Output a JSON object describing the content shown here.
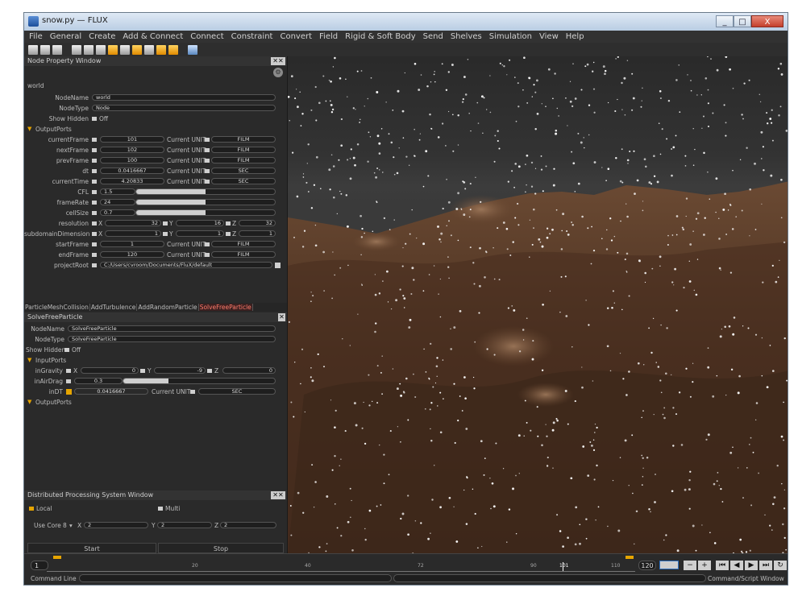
{
  "window": {
    "title": "snow.py — FLUX",
    "min": "_",
    "max": "□",
    "close": "X"
  },
  "menu": [
    "File",
    "General",
    "Create",
    "Add & Connect",
    "Connect",
    "Constraint",
    "Convert",
    "Field",
    "Rigid & Soft Body",
    "Send",
    "Shelves",
    "Simulation",
    "View",
    "Help"
  ],
  "node_property": {
    "title": "Node Property Window",
    "node": "world",
    "node_name_label": "NodeName",
    "node_name": "world",
    "node_type_label": "NodeType",
    "node_type": "Node",
    "show_hidden_label": "Show Hidden",
    "show_hidden": "Off",
    "output_ports": "OutputPorts",
    "unit_label": "Current UNIT",
    "ports": {
      "currentFrame": {
        "label": "currentFrame",
        "value": "101",
        "unit": "FILM"
      },
      "nextFrame": {
        "label": "nextFrame",
        "value": "102",
        "unit": "FILM"
      },
      "prevFrame": {
        "label": "prevFrame",
        "value": "100",
        "unit": "FILM"
      },
      "dt": {
        "label": "dt",
        "value": "0.0416667",
        "unit": "SEC"
      },
      "currentTime": {
        "label": "currentTime",
        "value": "4.20833",
        "unit": "SEC"
      },
      "CFL": {
        "label": "CFL",
        "value": "1.5",
        "fill": 0.5
      },
      "frameRate": {
        "label": "frameRate",
        "value": "24",
        "fill": 0.5
      },
      "cellSize": {
        "label": "cellSize",
        "value": "0.7",
        "fill": 0.5
      },
      "resolution": {
        "label": "resolution",
        "x": "32",
        "y": "16",
        "z": "32"
      },
      "subdomain": {
        "label": "subdomainDimension",
        "x": "1",
        "y": "1",
        "z": "1"
      },
      "startFrame": {
        "label": "startFrame",
        "value": "1",
        "unit": "FILM"
      },
      "endFrame": {
        "label": "endFrame",
        "value": "120",
        "unit": "FILM"
      },
      "projectRoot": {
        "label": "projectRoot",
        "value": "C:/Users/cvroom/Documents/FluX/default"
      }
    }
  },
  "tabs": [
    "ParticleMeshCollision",
    "AddTurbulence",
    "AddRandomParticle",
    "SolveFreeParticle"
  ],
  "solve": {
    "title": "SolveFreeParticle",
    "node_name": "SolveFreeParticle",
    "node_type": "SolveFreeParticle",
    "show_hidden": "Off",
    "input_ports": "InputPorts",
    "output_ports": "OutputPorts",
    "gravity_label": "inGravity",
    "gx": "0",
    "gy": "-9",
    "gz": "0",
    "airdrag_label": "inAirDrag",
    "airdrag": "0.3",
    "airdrag_fill": 0.3,
    "dt_label": "inDT",
    "dt": "0.0416667",
    "dt_unit": "SEC"
  },
  "dps": {
    "title": "Distributed Processing System Window",
    "local": "Local",
    "multi": "Multi",
    "use_core": "Use Core",
    "core": "8",
    "x": "2",
    "y": "2",
    "z": "2",
    "start": "Start",
    "stop": "Stop"
  },
  "timeline": {
    "start": "1",
    "end": "120",
    "current": "101",
    "ticks": [
      "20",
      "40",
      "72",
      "90",
      "101",
      "110"
    ],
    "fps_btn": "",
    "command_line": "Command Line",
    "script_window": "Command/Script Window"
  },
  "axis": {
    "x": "X",
    "y": "Y",
    "z": "Z"
  }
}
